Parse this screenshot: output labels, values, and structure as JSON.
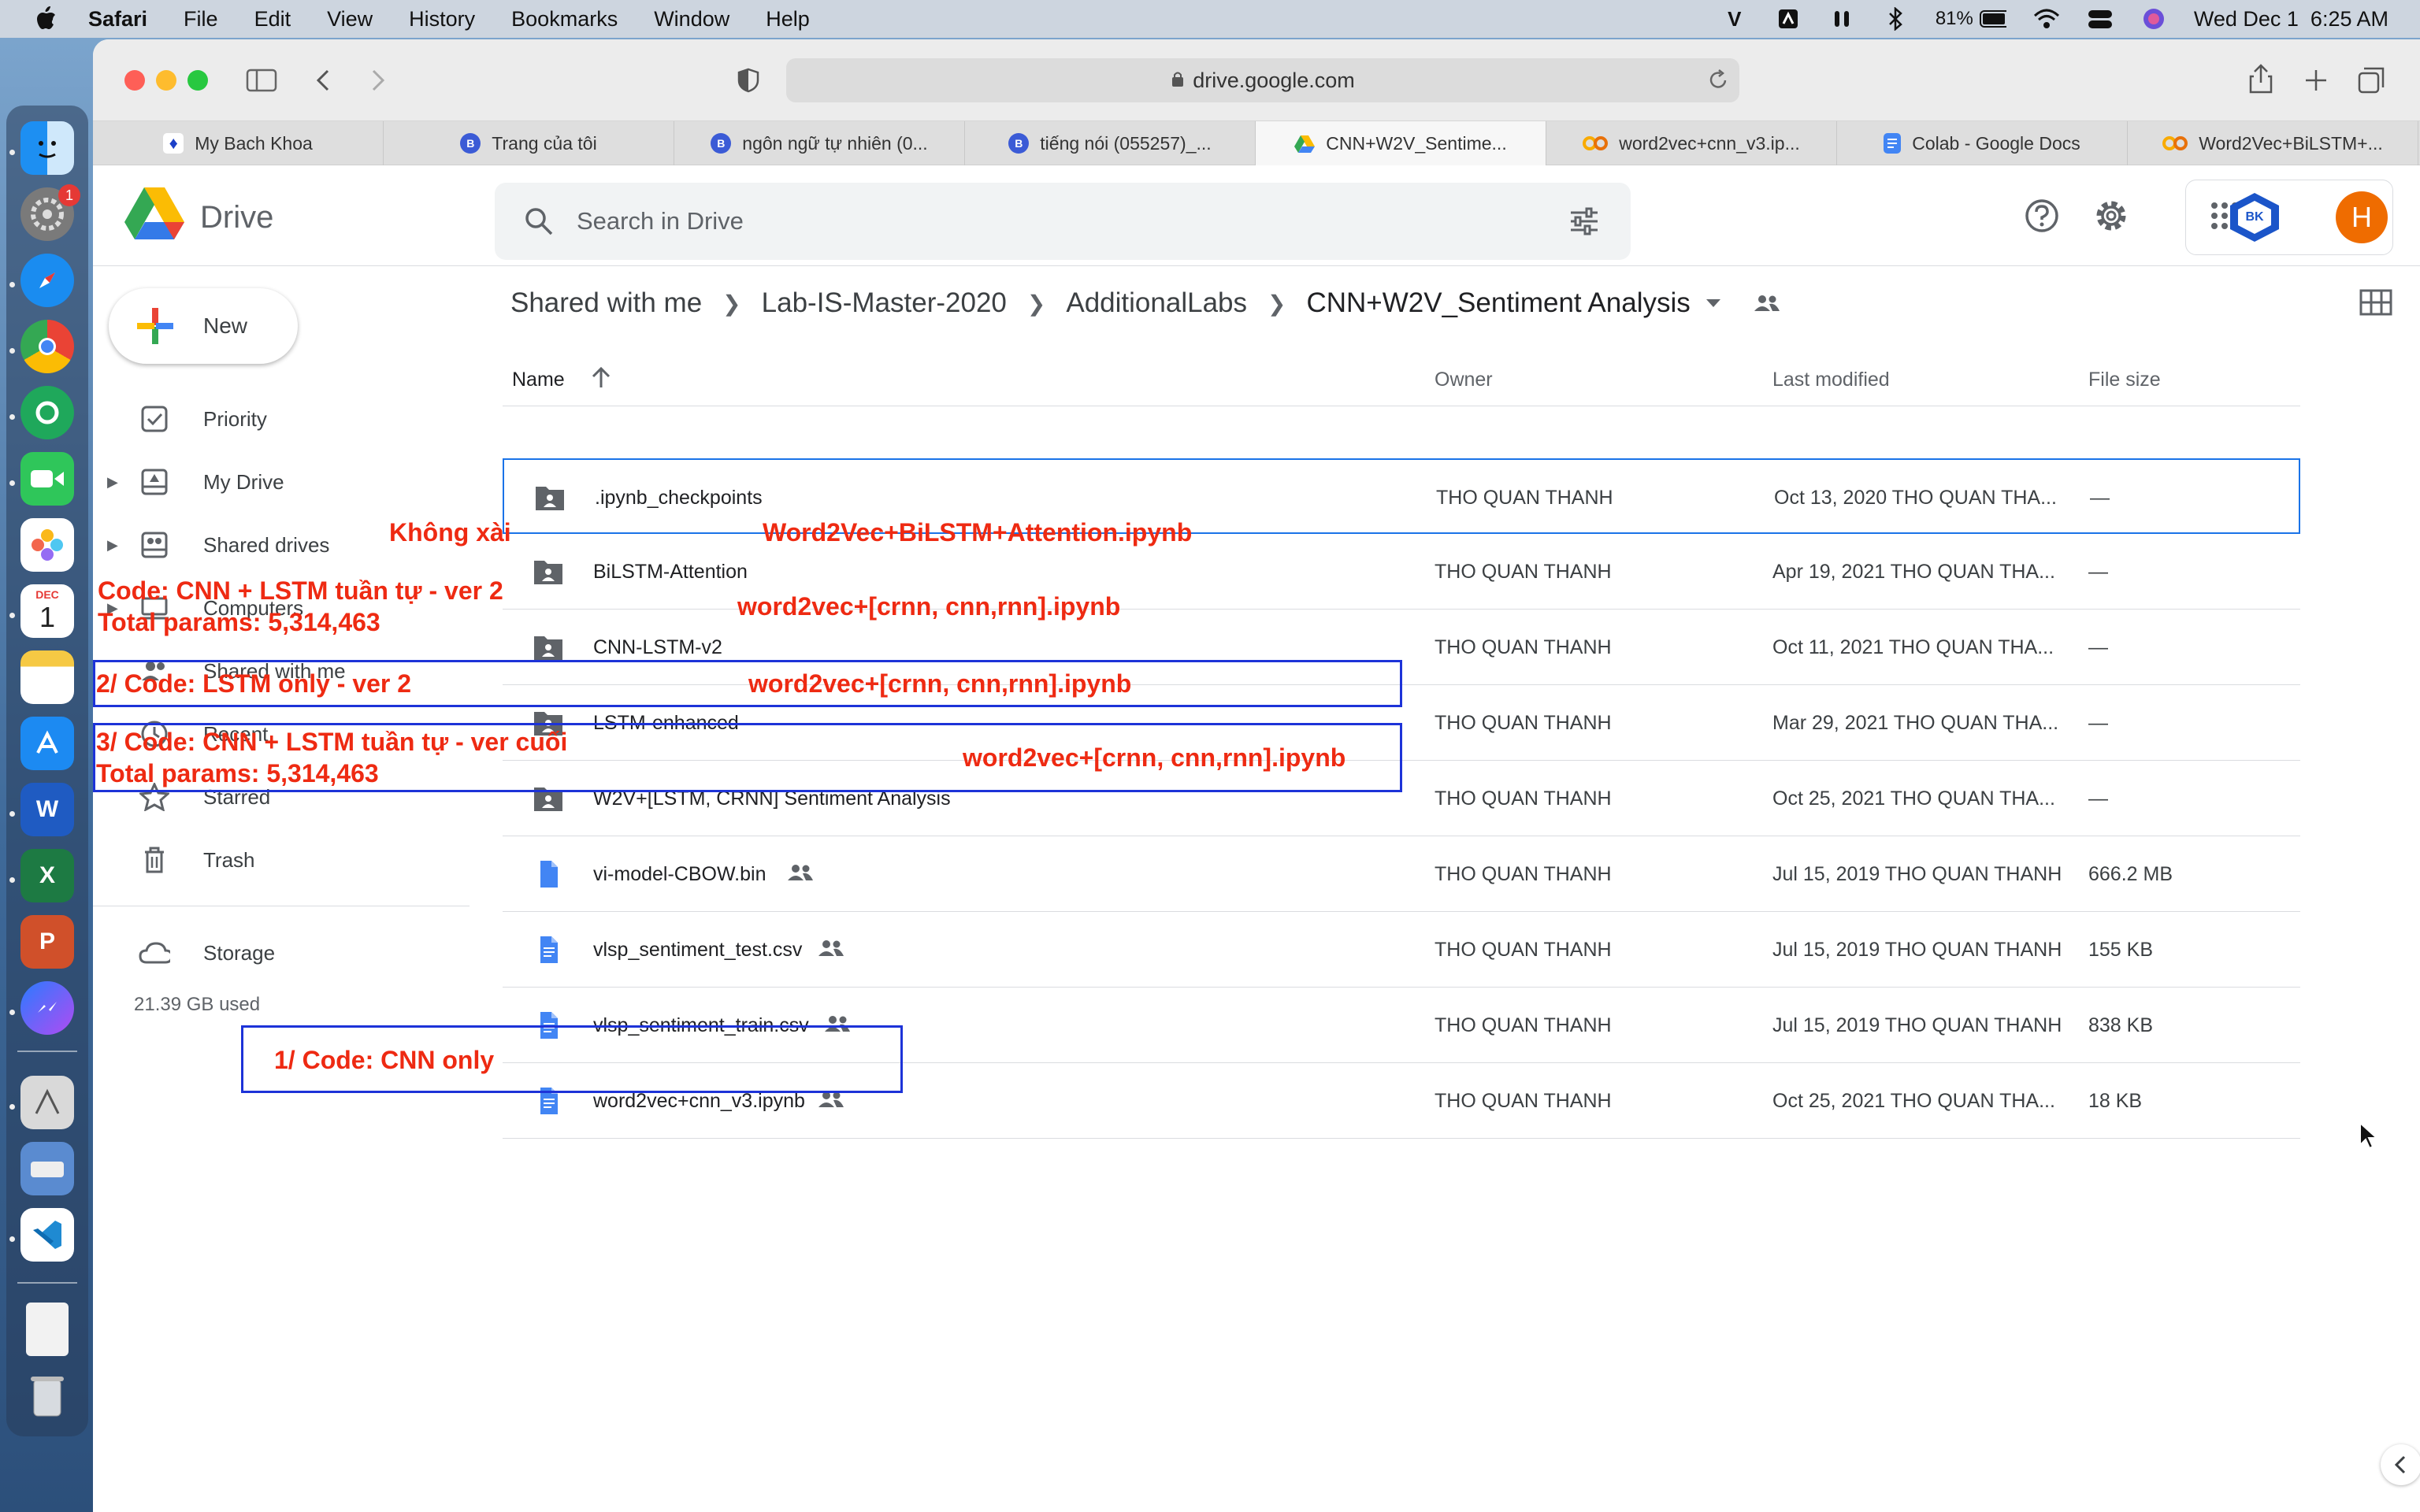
{
  "menubar": {
    "app": "Safari",
    "items": [
      "File",
      "Edit",
      "View",
      "History",
      "Bookmarks",
      "Window",
      "Help"
    ],
    "battery": "81%",
    "datetime": "Wed Dec 1  6:25 AM"
  },
  "dock": {
    "calendar_month": "DEC",
    "calendar_day": "1",
    "settings_badge": "1"
  },
  "browser": {
    "url": "drive.google.com",
    "tabs": [
      {
        "title": "My Bach Khoa",
        "icon": "tab-bk-icon",
        "active": false
      },
      {
        "title": "Trang của tôi",
        "icon": "tab-bkel-icon",
        "active": false
      },
      {
        "title": "ngôn ngữ tự nhiên (0...",
        "icon": "tab-bkel-icon",
        "active": false
      },
      {
        "title": "tiếng nói (055257)_...",
        "icon": "tab-bkel-icon",
        "active": false
      },
      {
        "title": "CNN+W2V_Sentime...",
        "icon": "tab-drive-icon",
        "active": true
      },
      {
        "title": "word2vec+cnn_v3.ip...",
        "icon": "tab-colab-icon",
        "active": false
      },
      {
        "title": "Colab - Google Docs",
        "icon": "tab-docs-icon",
        "active": false
      },
      {
        "title": "Word2Vec+BiLSTM+...",
        "icon": "tab-colab-icon",
        "active": false
      }
    ]
  },
  "drive": {
    "brand": "Drive",
    "search_placeholder": "Search in Drive",
    "avatar_letter": "H",
    "org_logo": "BK",
    "new_label": "New",
    "sidebar": {
      "priority": "Priority",
      "my_drive": "My Drive",
      "shared_drives": "Shared drives",
      "computers": "Computers",
      "shared_with_me": "Shared with me",
      "recent": "Recent",
      "starred": "Starred",
      "trash": "Trash",
      "storage": "Storage",
      "storage_used": "21.39 GB used"
    },
    "breadcrumb": [
      "Shared with me",
      "Lab-IS-Master-2020",
      "AdditionalLabs",
      "CNN+W2V_Sentiment Analysis"
    ],
    "columns": {
      "name": "Name",
      "owner": "Owner",
      "last_modified": "Last modified",
      "file_size": "File size"
    },
    "files": [
      {
        "name": ".ipynb_checkpoints",
        "type": "folder",
        "shared": false,
        "owner": "THO QUAN THANH",
        "modified": "Oct 13, 2020  THO QUAN THA...",
        "size": "—"
      },
      {
        "name": "BiLSTM-Attention",
        "type": "folder",
        "shared": false,
        "owner": "THO QUAN THANH",
        "modified": "Apr 19, 2021  THO QUAN THA...",
        "size": "—"
      },
      {
        "name": "CNN-LSTM-v2",
        "type": "folder",
        "shared": false,
        "owner": "THO QUAN THANH",
        "modified": "Oct 11, 2021  THO QUAN THA...",
        "size": "—"
      },
      {
        "name": "LSTM-enhanced",
        "type": "folder",
        "shared": false,
        "owner": "THO QUAN THANH",
        "modified": "Mar 29, 2021  THO QUAN THA...",
        "size": "—"
      },
      {
        "name": "W2V+[LSTM, CRNN] Sentiment Analysis",
        "type": "folder",
        "shared": false,
        "owner": "THO QUAN THANH",
        "modified": "Oct 25, 2021  THO QUAN THA...",
        "size": "—"
      },
      {
        "name": "vi-model-CBOW.bin",
        "type": "file",
        "shared": true,
        "owner": "THO QUAN THANH",
        "modified": "Jul 15, 2019  THO QUAN THANH",
        "size": "666.2 MB"
      },
      {
        "name": "vlsp_sentiment_test.csv",
        "type": "file",
        "shared": true,
        "owner": "THO QUAN THANH",
        "modified": "Jul 15, 2019  THO QUAN THANH",
        "size": "155 KB"
      },
      {
        "name": "vlsp_sentiment_train.csv",
        "type": "file",
        "shared": true,
        "owner": "THO QUAN THANH",
        "modified": "Jul 15, 2019  THO QUAN THANH",
        "size": "838 KB"
      },
      {
        "name": "word2vec+cnn_v3.ipynb",
        "type": "file",
        "shared": true,
        "owner": "THO QUAN THANH",
        "modified": "Oct 25, 2021  THO QUAN THA...",
        "size": "18 KB"
      }
    ]
  },
  "annotations": {
    "khong_xai": "Không xài",
    "bilstm_nb": "Word2Vec+BiLSTM+Attention.ipynb",
    "cnnlstm_nb": "word2vec+[crnn, cnn,rnn].ipynb",
    "lstm_nb": "word2vec+[crnn, cnn,rnn].ipynb",
    "w2v_nb": "word2vec+[crnn, cnn,rnn].ipynb",
    "note_ver2_line1": "Code: CNN + LSTM tuần tự - ver 2",
    "note_ver2_line2": "Total params: 5,314,463",
    "note_lstm": "2/ Code: LSTM only - ver 2",
    "note_final_line1": "3/ Code: CNN + LSTM tuần tự - ver cuối",
    "note_final_line2": "Total params: 5,314,463",
    "note_cnn": "1/ Code: CNN only"
  },
  "colors": {
    "annotation_text": "#ee2a12",
    "annotation_box": "#1d33d8",
    "selection": "#1a73e8"
  }
}
